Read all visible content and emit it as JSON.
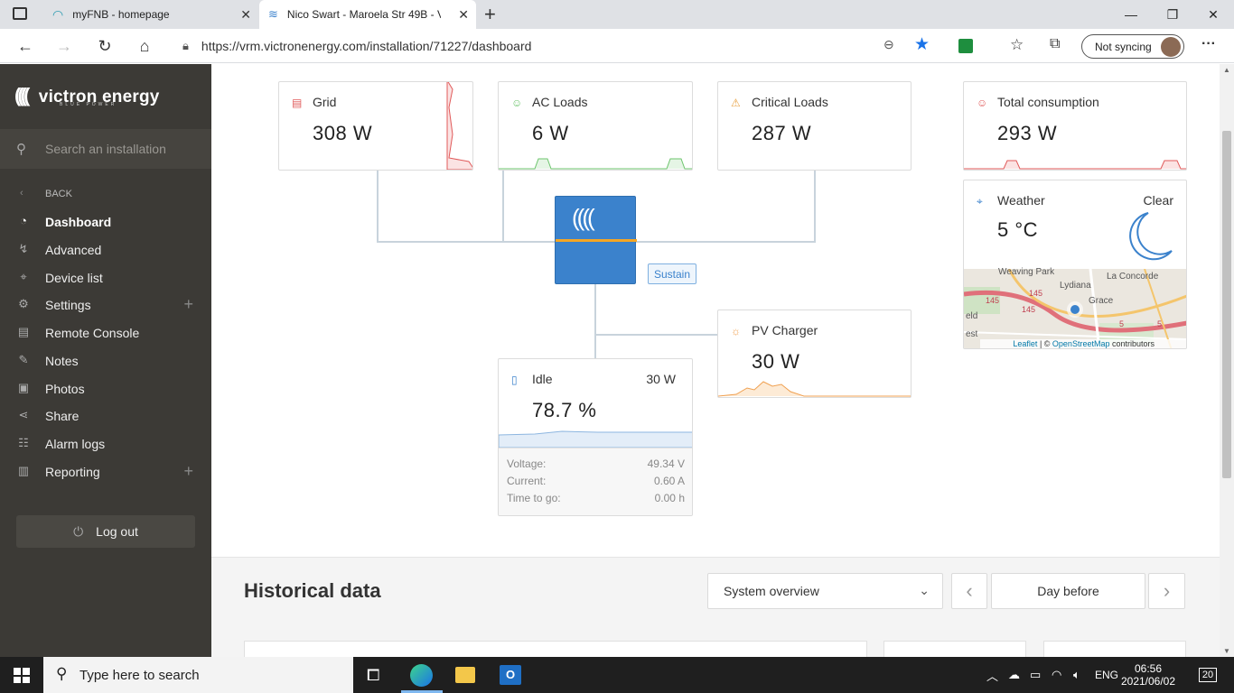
{
  "browser": {
    "tabs": [
      {
        "title": "myFNB - homepage",
        "close": "✕"
      },
      {
        "title": "Nico Swart - Maroela Str 49B - V",
        "close": "✕"
      }
    ],
    "new_tab": "+",
    "url": "https://vrm.victronenergy.com/installation/71227/dashboard",
    "sync_label": "Not syncing",
    "more": "···"
  },
  "sidebar": {
    "brand": "victron energy",
    "brand_sub": "BLUE POWER",
    "search_placeholder": "Search an installation",
    "back_label": "BACK",
    "items": [
      {
        "label": "Dashboard",
        "icon": "dashboard-icon"
      },
      {
        "label": "Advanced",
        "icon": "advanced-icon"
      },
      {
        "label": "Device list",
        "icon": "device-list-icon"
      },
      {
        "label": "Settings",
        "icon": "gear-icon"
      },
      {
        "label": "Remote Console",
        "icon": "console-icon"
      },
      {
        "label": "Notes",
        "icon": "notes-icon"
      },
      {
        "label": "Photos",
        "icon": "photos-icon"
      },
      {
        "label": "Share",
        "icon": "share-icon"
      },
      {
        "label": "Alarm logs",
        "icon": "alarm-icon"
      },
      {
        "label": "Reporting",
        "icon": "reporting-icon"
      }
    ],
    "logout": "Log out"
  },
  "dashboard": {
    "grid": {
      "label": "Grid",
      "value": "308 W"
    },
    "ac_loads": {
      "label": "AC Loads",
      "value": "6 W"
    },
    "critical_loads": {
      "label": "Critical Loads",
      "value": "287 W"
    },
    "total_consumption": {
      "label": "Total consumption",
      "value": "293 W"
    },
    "weather": {
      "label": "Weather",
      "condition": "Clear",
      "temp": "5 °C"
    },
    "map": {
      "places": [
        "Weaving Park",
        "La Concorde",
        "Lydiana",
        "Grace",
        "145",
        "145",
        "145",
        "5",
        "5",
        "eld",
        "est"
      ],
      "attribution": "Leaflet | © OpenStreetMap contributors",
      "attr_leaflet": "Leaflet",
      "attr_sep": " | © ",
      "attr_osm": "OpenStreetMap",
      "attr_tail": " contributors"
    },
    "inverter_tag": "Sustain",
    "pv_charger": {
      "label": "PV Charger",
      "value": "30 W"
    },
    "battery": {
      "state": "Idle",
      "power": "30 W",
      "soc": "78.7 %",
      "rows": [
        {
          "k": "Voltage:",
          "v": "49.34 V"
        },
        {
          "k": "Current:",
          "v": "0.60 A"
        },
        {
          "k": "Time to go:",
          "v": "0.00 h"
        }
      ]
    }
  },
  "historical": {
    "title": "Historical data",
    "select": "System overview",
    "period": "Day before",
    "prev": "‹",
    "next": "›"
  },
  "taskbar": {
    "search_placeholder": "Type here to search",
    "lang": "ENG",
    "time": "06:56",
    "date": "2021/06/02",
    "notifications": "20"
  },
  "colors": {
    "sidebar_bg": "#3c3a36",
    "accent_blue": "#3b82cc",
    "grid_red": "#e05a5a",
    "ac_green": "#6cc46c",
    "pv_orange": "#f0a050",
    "critical_orange": "#e8a040"
  }
}
